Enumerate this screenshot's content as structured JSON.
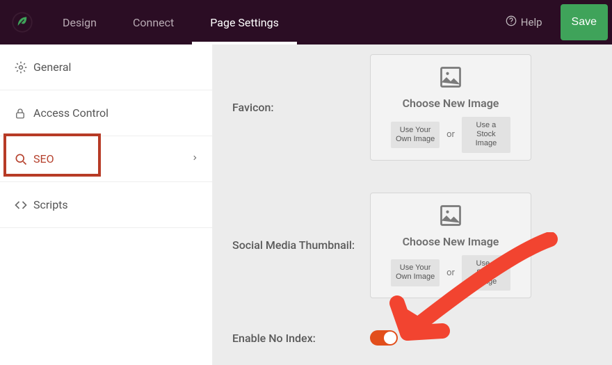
{
  "header": {
    "tabs": [
      "Design",
      "Connect",
      "Page Settings"
    ],
    "active_tab": 2,
    "help": "Help",
    "save": "Save"
  },
  "sidebar": {
    "items": [
      {
        "id": "general",
        "label": "General",
        "icon": "gear"
      },
      {
        "id": "access",
        "label": "Access Control",
        "icon": "lock"
      },
      {
        "id": "seo",
        "label": "SEO",
        "icon": "search",
        "active": true
      },
      {
        "id": "scripts",
        "label": "Scripts",
        "icon": "code"
      }
    ]
  },
  "seo": {
    "favicon": {
      "label": "Favicon:",
      "choose": "Choose New Image",
      "own": "Use Your Own Image",
      "or": "or",
      "stock": "Use a Stock Image"
    },
    "social": {
      "label": "Social Media Thumbnail:",
      "choose": "Choose New Image",
      "own": "Use Your Own Image",
      "or": "or",
      "stock": "Use a Stock Image"
    },
    "noindex": {
      "label": "Enable No Index:",
      "value": true
    }
  }
}
